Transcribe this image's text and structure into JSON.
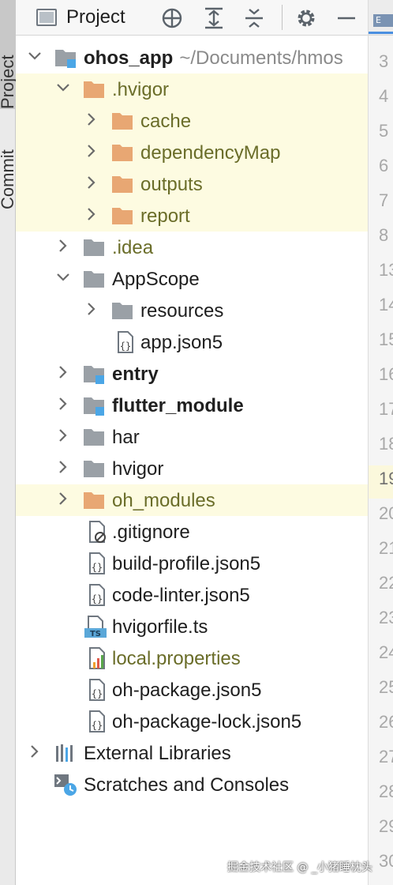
{
  "side_strip": {
    "project_tab": "Project",
    "commit_tab": "Commit"
  },
  "toolbar": {
    "title": "Project",
    "icons": [
      "crosshair-icon",
      "expand-all-icon",
      "collapse-all-icon",
      "gear-icon",
      "minimize-icon"
    ]
  },
  "tree": {
    "root": {
      "name": "ohos_app",
      "path": "~/Documents/hmos"
    },
    "hvigor_dir": ".hvigor",
    "hvigor_children": [
      "cache",
      "dependencyMap",
      "outputs",
      "report"
    ],
    "idea": ".idea",
    "appscope": "AppScope",
    "appscope_resources": "resources",
    "appscope_json": "app.json5",
    "entry": "entry",
    "flutter_module": "flutter_module",
    "har": "har",
    "hvigor": "hvigor",
    "oh_modules": "oh_modules",
    "files": {
      "gitignore": ".gitignore",
      "build_profile": "build-profile.json5",
      "code_linter": "code-linter.json5",
      "hvigorfile": "hvigorfile.ts",
      "local_properties": "local.properties",
      "oh_package": "oh-package.json5",
      "oh_package_lock": "oh-package-lock.json5"
    },
    "external_libraries": "External Libraries",
    "scratches": "Scratches and Consoles"
  },
  "editor": {
    "tab_badge": "E",
    "line_numbers": [
      "3",
      "4",
      "5",
      "6",
      "7",
      "8",
      "13",
      "14",
      "15",
      "16",
      "17",
      "18",
      "19",
      "20",
      "21",
      "22",
      "23",
      "24",
      "25",
      "26",
      "27",
      "28",
      "29",
      "30"
    ],
    "current_line": "19"
  },
  "watermark": "掘金技术社区 @ _小猪睡枕头",
  "colors": {
    "folder": "#e8a773",
    "folder_gray": "#9aa0a6",
    "module_badge": "#4ba6e6",
    "highlight_row": "#fdfbe1",
    "excluded_text": "#6a6d29"
  }
}
